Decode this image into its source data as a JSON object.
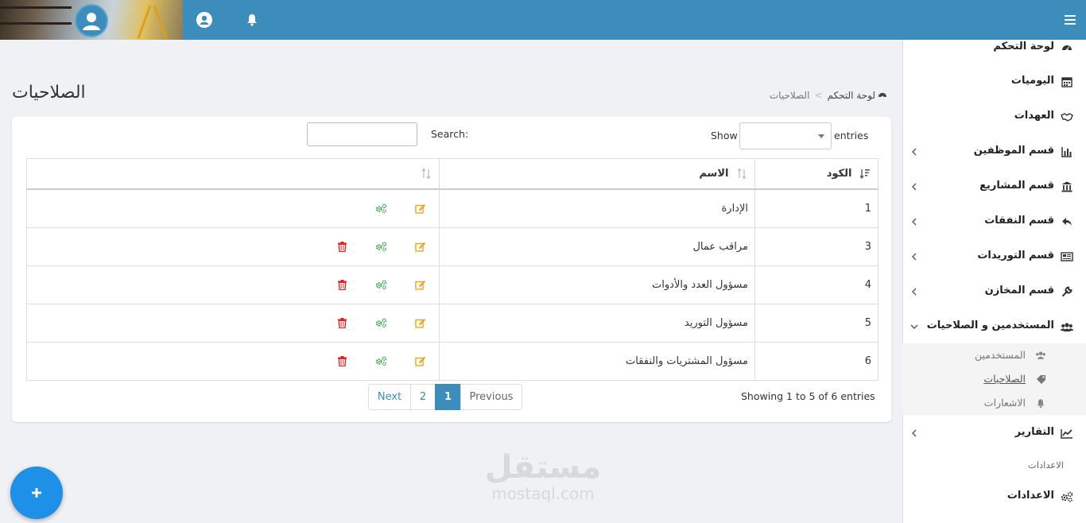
{
  "header": {
    "brand_icon": "user-circle-icon",
    "user_icon": "user-circle-icon",
    "notification_icon": "bell-icon",
    "menu_icon": "bars-icon",
    "bar_color": "#3c8dbc"
  },
  "sidebar": {
    "items": [
      {
        "label": "لوحة التحكم",
        "icon": "dashboard-icon",
        "has_children": false
      },
      {
        "label": "اليوميات",
        "icon": "calendar-icon",
        "has_children": false
      },
      {
        "label": "العهدات",
        "icon": "handshake-icon",
        "has_children": false
      },
      {
        "label": "قسم الموظفين",
        "icon": "bar-chart-icon",
        "has_children": true
      },
      {
        "label": "قسم المشاريع",
        "icon": "bank-icon",
        "has_children": true
      },
      {
        "label": "قسم النفقات",
        "icon": "reply-icon",
        "has_children": true
      },
      {
        "label": "قسم التوريدات",
        "icon": "newspaper-icon",
        "has_children": true
      },
      {
        "label": "قسم المخازن",
        "icon": "wrench-icon",
        "has_children": true
      },
      {
        "label": "المستخدمين و الصلاحيات",
        "icon": "users-icon",
        "has_children": true,
        "expanded": true
      },
      {
        "label": "التقارير",
        "icon": "line-chart-icon",
        "has_children": true
      },
      {
        "label": "الاعدادات",
        "icon": "cogs-icon",
        "has_children": false
      }
    ],
    "submenu": [
      {
        "label": "المستخدمين",
        "icon": "users-icon"
      },
      {
        "label": "الصلاحيات",
        "icon": "tag-icon",
        "active": true
      },
      {
        "label": "الاشعارات",
        "icon": "bell-icon"
      }
    ],
    "section_label": "الاعدادات"
  },
  "page": {
    "title": "الصلاحيات",
    "breadcrumb": {
      "home": "لوحة التحكم",
      "current": "الصلاحيات"
    }
  },
  "table_controls": {
    "search_label": "Search:",
    "search_value": "",
    "show_label": "Show",
    "entries_label": "entries",
    "length_value": ""
  },
  "table": {
    "columns": [
      "الكود",
      "الاسم",
      ""
    ],
    "rows": [
      {
        "code": "1",
        "name": "الإدارة",
        "deletable": false
      },
      {
        "code": "3",
        "name": "مراقب عمال",
        "deletable": true
      },
      {
        "code": "4",
        "name": "مسؤول العدد والأدوات",
        "deletable": true
      },
      {
        "code": "5",
        "name": "مسؤول التوريد",
        "deletable": true
      },
      {
        "code": "6",
        "name": "مسؤول المشتريات والنفقات",
        "deletable": true
      }
    ]
  },
  "footer": {
    "info": "Showing 1 to 5 of 6 entries",
    "pagination": {
      "next": "Next",
      "pages": [
        "2",
        "1"
      ],
      "current": "1",
      "previous": "Previous"
    }
  },
  "watermark": {
    "arabic": "مستقل",
    "latin": "mostaql.com"
  },
  "fab": {
    "icon": "plus-icon"
  },
  "colors": {
    "edit": "#f39c12",
    "perm": "#2e9e3e",
    "delete": "#dd2222",
    "accent": "#3c8dbc"
  }
}
